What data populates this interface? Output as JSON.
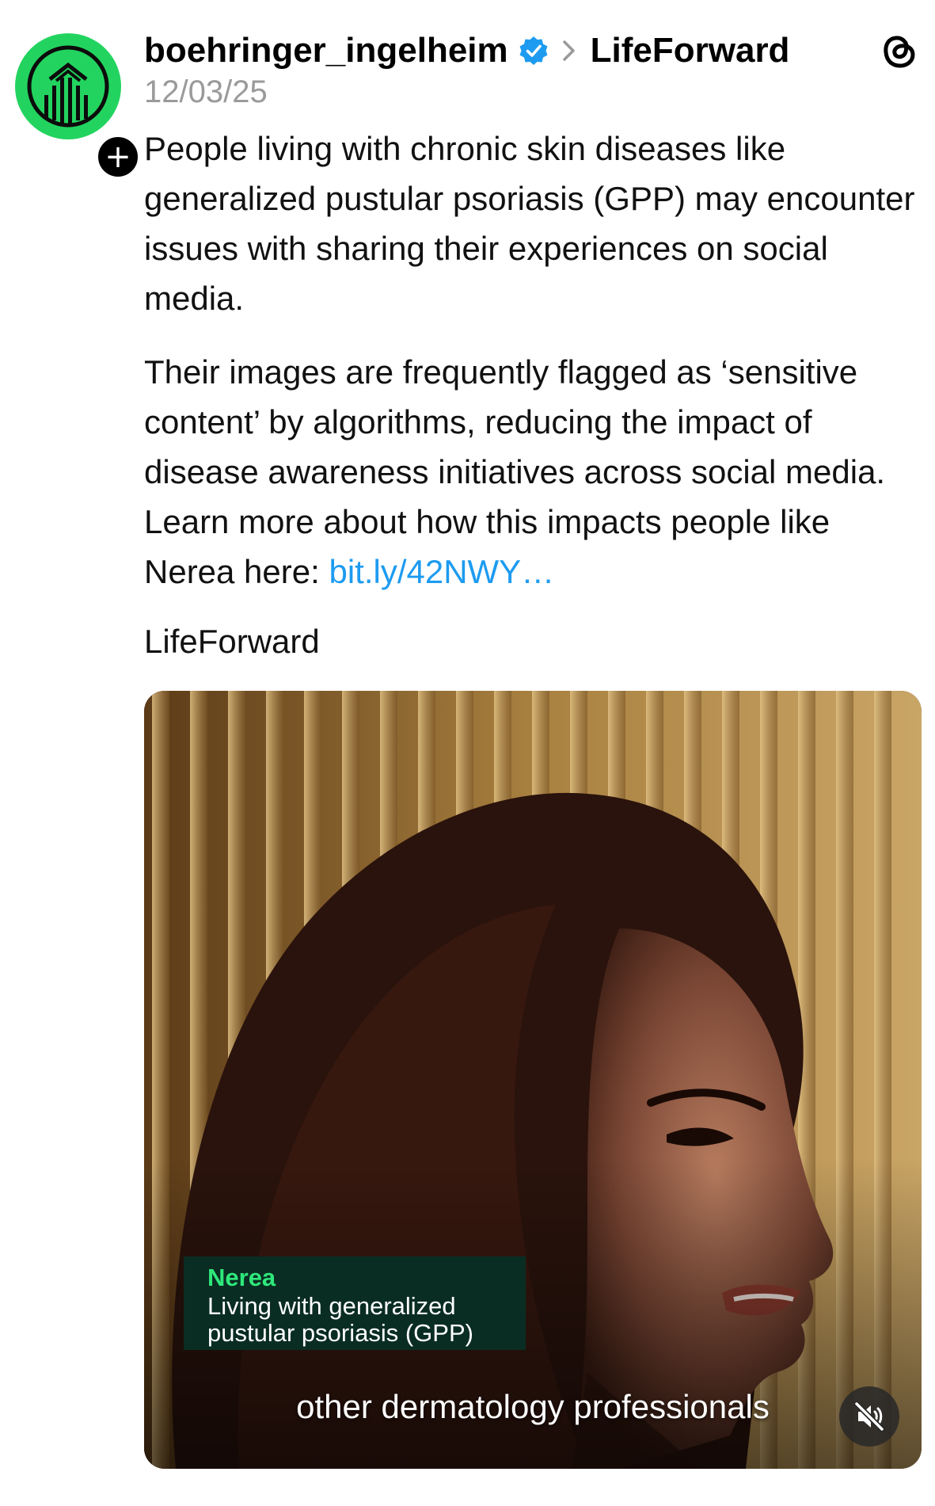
{
  "post": {
    "author": {
      "username": "boehringer_ingelheim",
      "verified": true,
      "avatar_icon": "boehringer-logo-icon",
      "follow_icon": "plus-icon",
      "follow_symbol": "+"
    },
    "community": "LifeForward",
    "date": "12/03/25",
    "app_icon": "threads-icon",
    "body": {
      "paragraph_1": "People living with chronic skin diseases like generalized pustular psoriasis (GPP) may encounter issues with sharing their experiences on social media.",
      "paragraph_2": "Their images are frequently flagged as ‘sensitive content’ by algorithms, reducing the impact of disease awareness initiatives across social media. Learn more about how this impacts people like Nerea here: ",
      "link_text": "bit.ly/42NWY…"
    },
    "topic_tag": "LifeForward",
    "video": {
      "lower_third_name": "Nerea",
      "lower_third_description": "Living with generalized pustular psoriasis (GPP)",
      "subtitle": "other dermatology professionals",
      "mute_icon": "speaker-muted-icon"
    }
  },
  "colors": {
    "avatar_green": "#22d45f",
    "link_blue": "#1d9bf0",
    "verified_blue": "#1d9bf0",
    "date_gray": "#9a9a9a",
    "lower_third_bg": "#083026",
    "lower_third_name": "#2ee87a"
  }
}
